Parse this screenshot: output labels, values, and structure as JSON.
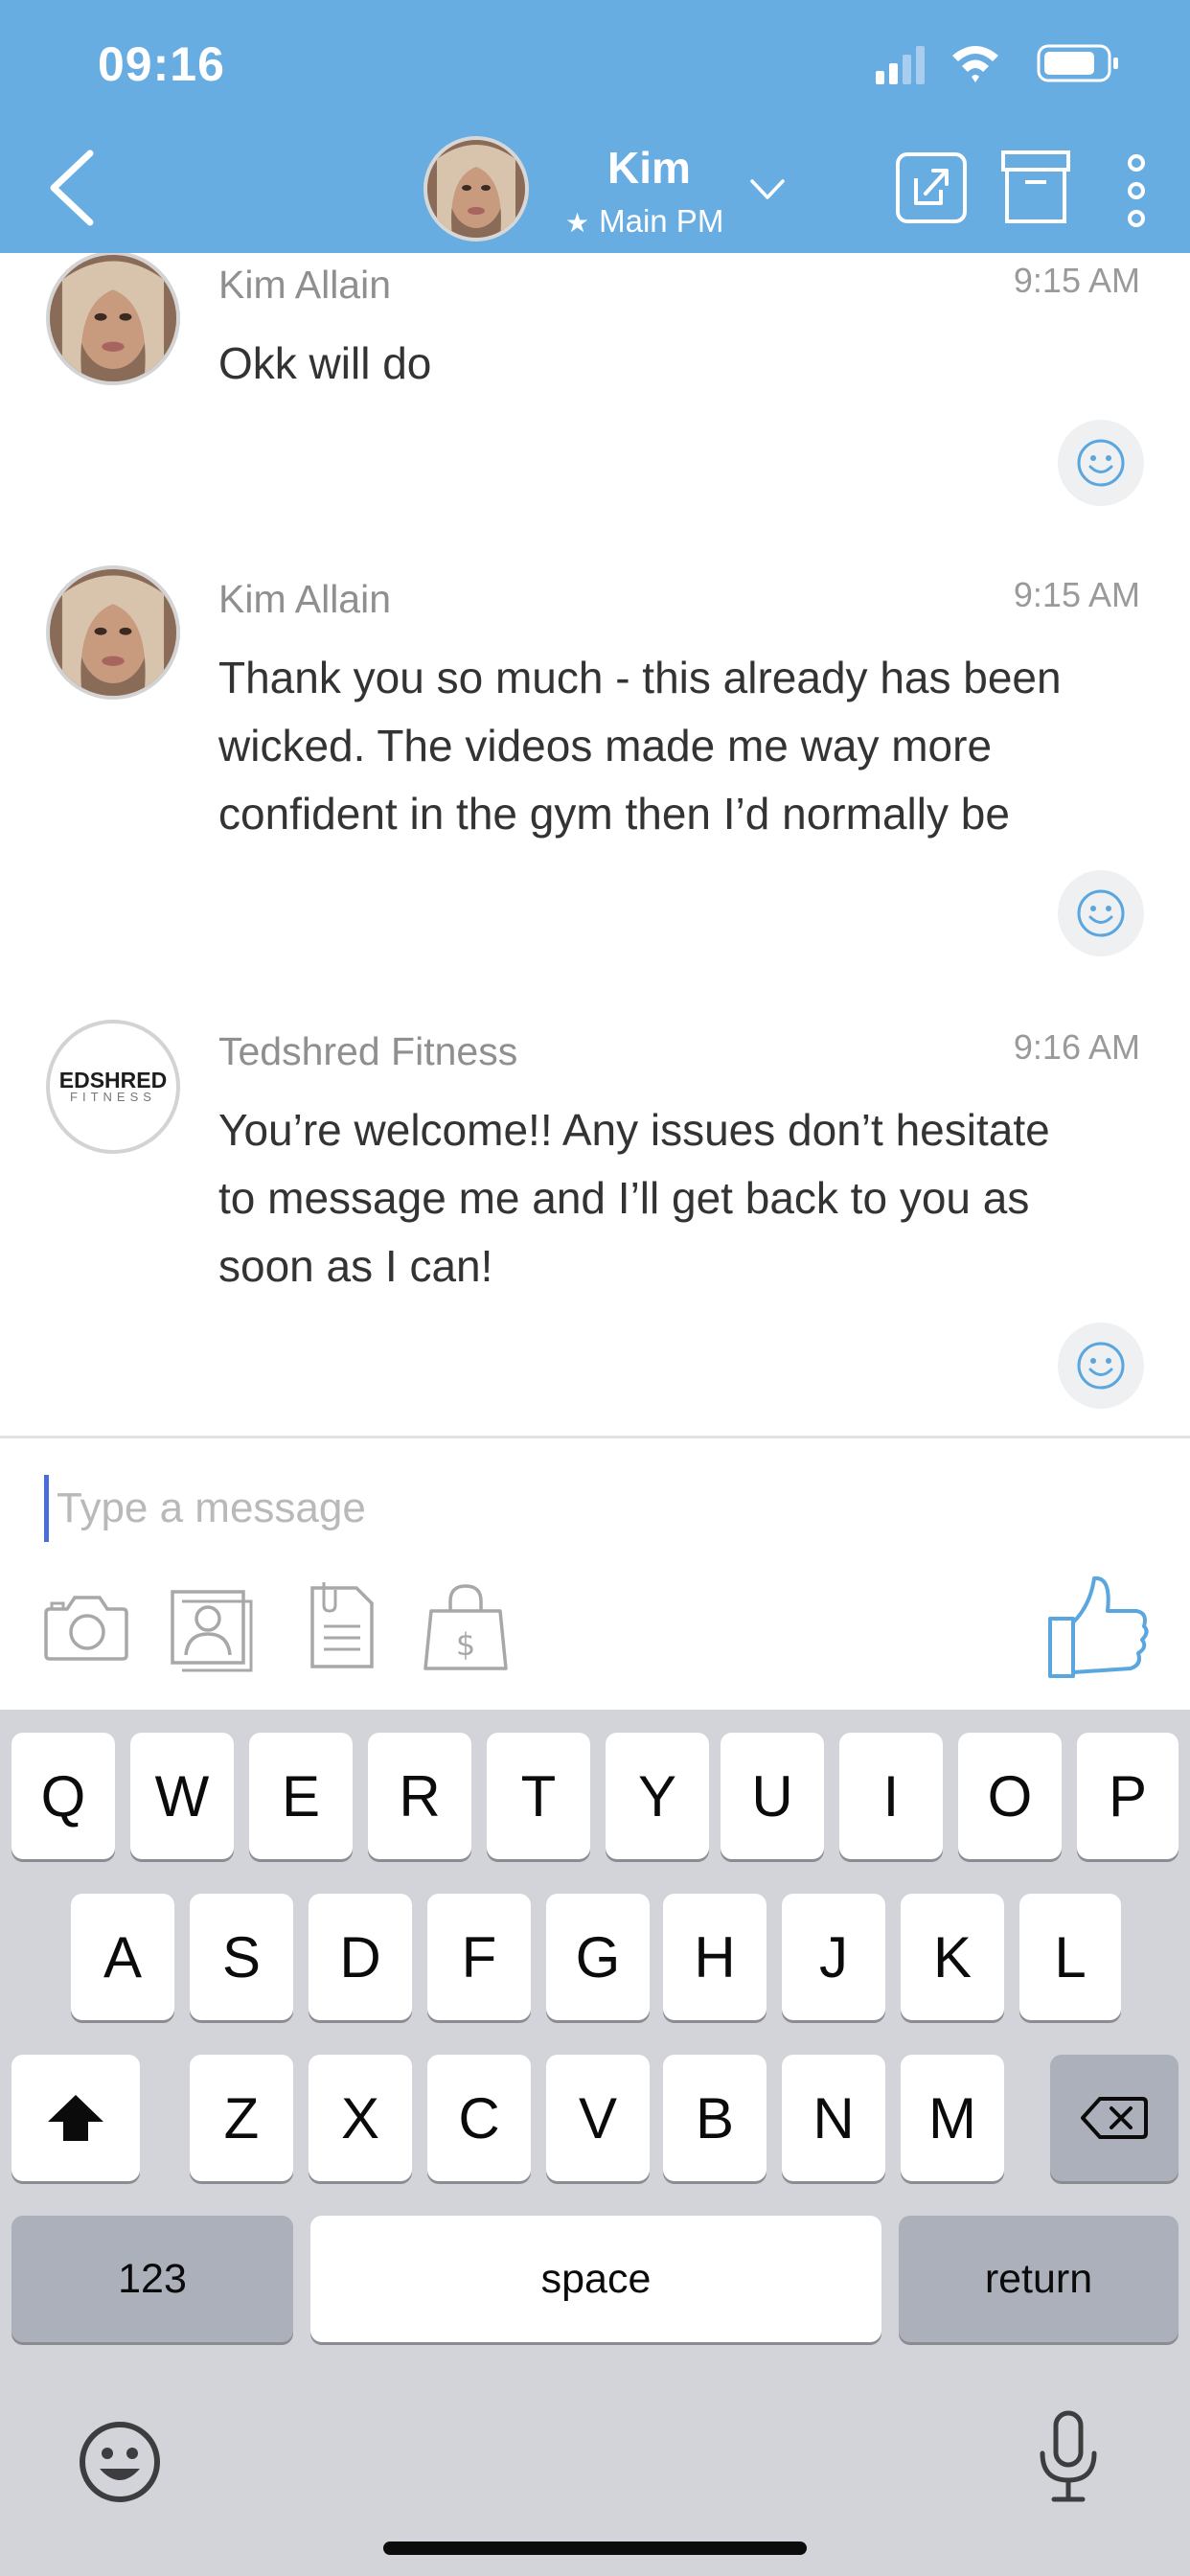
{
  "status_bar": {
    "time": "09:16"
  },
  "nav": {
    "name": "Kim",
    "subtitle_star": "★",
    "subtitle": "Main PM",
    "icons": [
      "back-chevron-icon",
      "chevron-down-icon",
      "share-external-icon",
      "archive-icon",
      "more-vertical-icon"
    ]
  },
  "messages": [
    {
      "sender": "Kim Allain",
      "time": "9:15 AM",
      "text": "Okk will do"
    },
    {
      "sender": "Kim Allain",
      "time": "9:15 AM",
      "text": "Thank you so much - this already has been\nwicked. The videos made me way more\nconfident in the gym then I’d normally be"
    },
    {
      "sender": "Tedshred Fitness",
      "time": "9:16 AM",
      "text": "You’re welcome!! Any issues don’t hesitate\nto message me and I’ll get back to you as\nsoon as I can!",
      "avatar_brand_top": "EDSHRED",
      "avatar_brand_bottom": "FITNESS"
    }
  ],
  "composer": {
    "placeholder": "Type a message",
    "value": "",
    "tools": [
      "camera-icon",
      "contact-card-icon",
      "document-icon",
      "shopping-bag-dollar-icon",
      "thumbs-up-icon"
    ]
  },
  "keyboard": {
    "row1": [
      "Q",
      "W",
      "E",
      "R",
      "T",
      "Y",
      "U",
      "I",
      "O",
      "P"
    ],
    "row2": [
      "A",
      "S",
      "D",
      "F",
      "G",
      "H",
      "J",
      "K",
      "L"
    ],
    "row3": [
      "Z",
      "X",
      "C",
      "V",
      "B",
      "N",
      "M"
    ],
    "numbers_label": "123",
    "space_label": "space",
    "return_label": "return"
  },
  "colors": {
    "header_bg": "#68ade2",
    "accent_blue": "#5aa6df",
    "keyboard_bg": "#d2d4d9"
  }
}
